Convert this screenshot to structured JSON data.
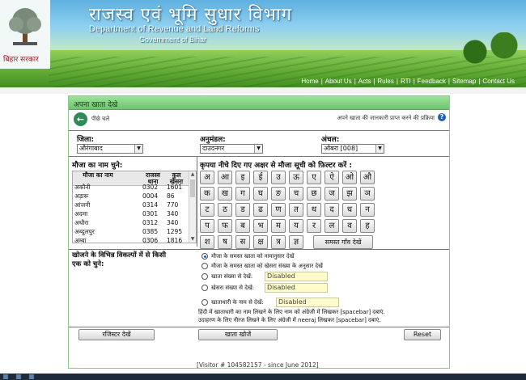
{
  "header": {
    "title_hindi": "राजस्व एवं भूमि सुधार विभाग",
    "title_english": "Department of Revenue and Land Reforms",
    "subtitle": "Government of Bihar",
    "logo_label": "बिहार सरकार",
    "nav": [
      "Home",
      "About Us",
      "Acts",
      "Rules",
      "RTI",
      "Feedback",
      "Sitemap",
      "Contact Us"
    ]
  },
  "panel": {
    "title": "अपना खाता देखे",
    "back_label": "पीछे चले",
    "help_label": "अपने खाता की जानकारी प्राप्त करने की प्रक्रिया",
    "district_label": "जिला:",
    "district_value": "औरंगाबाद",
    "subdivision_label": "अनुमंडल:",
    "subdivision_value": "दाउदनगर",
    "circle_label": "अंचल:",
    "circle_value": "ओबरा [008]",
    "mouza_select_label": "मौजा का नाम चुने:",
    "filter_label": "कृपया नीचे दिए गए अक्षर से मौजा सूची को फ़िल्टर करें :",
    "mouza_list": {
      "headers": [
        "मौजा का नाम",
        "राजस्व थाना",
        "कुल खेसरा"
      ],
      "rows": [
        [
          "अकौनी",
          "0302",
          "1601"
        ],
        [
          "अड़ारू",
          "0004",
          "86"
        ],
        [
          "आंजनी",
          "0314",
          "770"
        ],
        [
          "अदमा",
          "0301",
          "340"
        ],
        [
          "अधौरा",
          "0312",
          "340"
        ],
        [
          "अब्दुलपुर",
          "0385",
          "1295"
        ],
        [
          "अम्बा",
          "0306",
          "1816"
        ]
      ]
    },
    "letters": [
      [
        "अ",
        "आ",
        "इ",
        "ई",
        "उ",
        "ऊ",
        "ए",
        "ऐ",
        "ओ",
        "औ"
      ],
      [
        "क",
        "ख",
        "ग",
        "घ",
        "ङ",
        "च",
        "छ",
        "ज",
        "झ",
        "ञ"
      ],
      [
        "ट",
        "ठ",
        "ड",
        "ढ",
        "ण",
        "त",
        "थ",
        "द",
        "ध",
        "न"
      ],
      [
        "प",
        "फ",
        "ब",
        "भ",
        "म",
        "य",
        "र",
        "ल",
        "व",
        "ह"
      ],
      [
        "श",
        "ष",
        "स",
        "क्ष",
        "त्र",
        "ज्ञ"
      ]
    ],
    "all_villages_btn": "समस्त गाँव देखें",
    "options_title": "खोजने के विभिन्न विकल्पों में से किसी एक को चुने:",
    "options": [
      {
        "label": "मौजा के समस्त खाता को नामानुसार देखें",
        "selected": true
      },
      {
        "label": "मौजा के समस्त खाता को खेसरा संख्या के अनुसार देखें",
        "selected": false
      },
      {
        "label": "खाता संख्या से देखें:",
        "selected": false,
        "input": "Disabled"
      },
      {
        "label": "खेसरा संख्या से देखें:",
        "selected": false,
        "input": "Disabled"
      },
      {
        "label": "खाताधारी के नाम से देखें:",
        "selected": false,
        "input": "Disabled"
      }
    ],
    "note_1": "हिंदी में खाताधारी का नाम लिखने के लिए नाम को अंग्रेजी में लिखकर [spacebar] दबाएं.",
    "note_2": "उदाहरण के लिए नीरज लिखने के लिए अंग्रेजी में neeraj लिखकर [spacebar] दबाएं.",
    "btn_register": "रजिस्टर देखें",
    "btn_search": "खाता खोजें",
    "btn_reset": "Reset",
    "visitor": "[Visitor #  104582157 - since June 2012]"
  }
}
